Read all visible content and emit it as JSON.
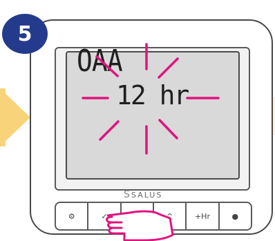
{
  "step": {
    "number": "5"
  },
  "display": {
    "mode": "OAA",
    "value": "12 hr"
  },
  "brand": {
    "logo_text": "SALUS",
    "logo_symbol": "S"
  },
  "buttons": [
    {
      "icon": "gear-icon",
      "label": "⚙"
    },
    {
      "icon": "check-icon",
      "label": "✓"
    },
    {
      "icon": "minus-icon",
      "label": ""
    },
    {
      "icon": "chevron-icon",
      "label": "^"
    },
    {
      "icon": "plus-hour",
      "label": "+Hr"
    },
    {
      "icon": "info-icon",
      "label": "●"
    }
  ],
  "colors": {
    "badge": "#243a8c",
    "blink": "#e0137f",
    "arrow": "#f8d37a"
  }
}
